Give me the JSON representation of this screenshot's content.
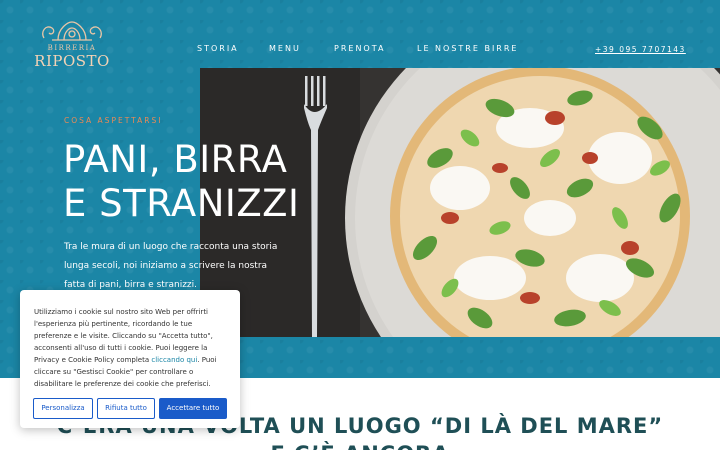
{
  "brand": {
    "name_top": "BIRRERIA",
    "name_main": "RIPOSTO",
    "accent_color": "#f3d2b5"
  },
  "nav": {
    "items": [
      {
        "label": "STORIA"
      },
      {
        "label": "MENU"
      },
      {
        "label": "PRENOTA"
      },
      {
        "label": "LE NOSTRE BIRRE"
      }
    ],
    "phone": "+39 095 7707143"
  },
  "hero": {
    "eyebrow": "COSA ASPETTARSI",
    "headline_line1": "PANI, BIRRA",
    "headline_line2": "E STRANIZZI",
    "intro": "Tra le mura di un luogo che racconta una storia lunga secoli, noi iniziamo a scrivere la nostra fatta di pani, birra e stranizzi.",
    "background_color": "#1b86a6",
    "eyebrow_color": "#ec8a55"
  },
  "section": {
    "heading_line1": "C’ERA UNA VOLTA UN LUOGO “DI LÀ DEL MARE”",
    "heading_line2": "E C’È ANCORA"
  },
  "cookie_banner": {
    "text_before": "Utilizziamo i cookie sul nostro sito Web per offrirti l'esperienza più pertinente, ricordando le tue preferenze e le visite. Cliccando su \"Accetta tutto\", acconsenti all'uso di tutti i cookie. Puoi leggere la Privacy e Cookie Policy completa ",
    "link_text": "cliccando qui",
    "text_after": ". Puoi cliccare su \"Gestisci Cookie\" per controllare o disabilitare le preferenze dei cookie che preferisci.",
    "buttons": {
      "customize": "Personalizza",
      "reject": "Rifiuta tutto",
      "accept": "Accettare tutto"
    },
    "button_color": "#1a5bc9"
  },
  "icons": {
    "logo": "ornament-logo-icon",
    "fork": "fork-icon",
    "pizza": "pizza-icon"
  }
}
